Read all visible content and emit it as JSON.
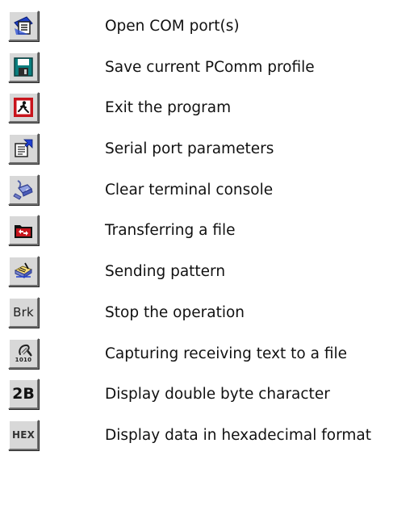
{
  "toolbar_legend": {
    "items": [
      {
        "icon": "open-port-icon",
        "label": "Open COM port(s)"
      },
      {
        "icon": "save-disk-icon",
        "label": "Save current PComm profile"
      },
      {
        "icon": "exit-door-icon",
        "label": "Exit the program"
      },
      {
        "icon": "port-parameters-icon",
        "label": "Serial port parameters"
      },
      {
        "icon": "clear-console-icon",
        "label": "Clear terminal console"
      },
      {
        "icon": "file-transfer-icon",
        "label": "Transferring a file"
      },
      {
        "icon": "send-pattern-icon",
        "label": "Sending pattern"
      },
      {
        "icon": "break-icon",
        "label": "Stop the operation",
        "icon_text": "Brk"
      },
      {
        "icon": "capture-text-icon",
        "label": "Capturing receiving text to a file",
        "icon_text": "1010"
      },
      {
        "icon": "double-byte-icon",
        "label": "Display double byte character",
        "icon_text": "2B"
      },
      {
        "icon": "hex-icon",
        "label": "Display data in hexadecimal format",
        "icon_text": "HEX"
      }
    ]
  },
  "colors": {
    "button_face": "#d8d8d8",
    "blue": "#1f3fd1",
    "red": "#c8141c",
    "green": "#0b7f7f"
  }
}
